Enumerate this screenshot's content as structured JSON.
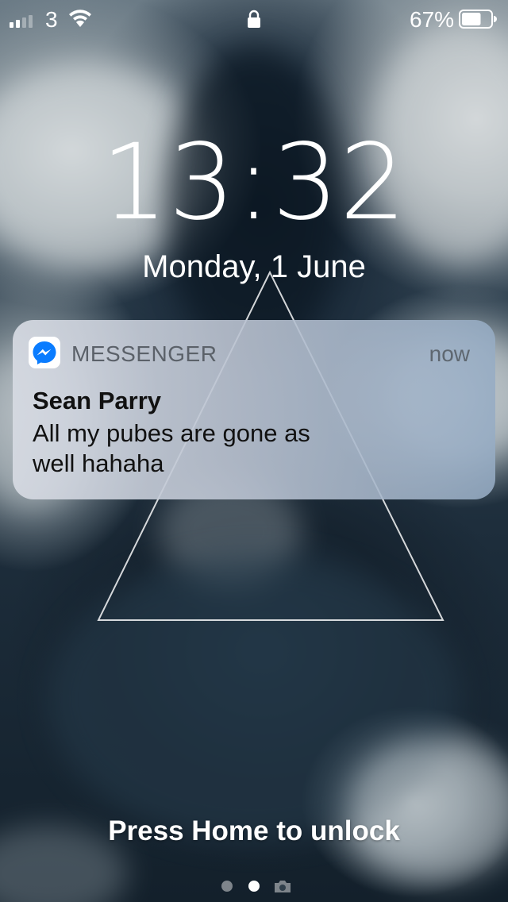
{
  "status_bar": {
    "carrier": "3",
    "signal_bars_filled": 2,
    "signal_bars_total": 4,
    "battery_percent": "67%",
    "battery_level": 0.67,
    "icons": [
      "signal-icon",
      "wifi-icon",
      "lock-icon",
      "battery-icon"
    ]
  },
  "lock_screen": {
    "time": "13:32",
    "date": "Monday, 1 June"
  },
  "notification": {
    "app_name": "MESSENGER",
    "app_icon": "messenger-icon",
    "time": "now",
    "sender": "Sean Parry",
    "message": "All my pubes are gone as well hahaha"
  },
  "bottom": {
    "unlock_hint": "Press Home to unlock",
    "page_count": 3,
    "current_page": 2,
    "last_page_icon": "camera-icon"
  },
  "colors": {
    "text": "#ffffff",
    "notification_text": "#111111",
    "notification_secondary": "#5b6169",
    "messenger_blue": "#0a7cff"
  }
}
